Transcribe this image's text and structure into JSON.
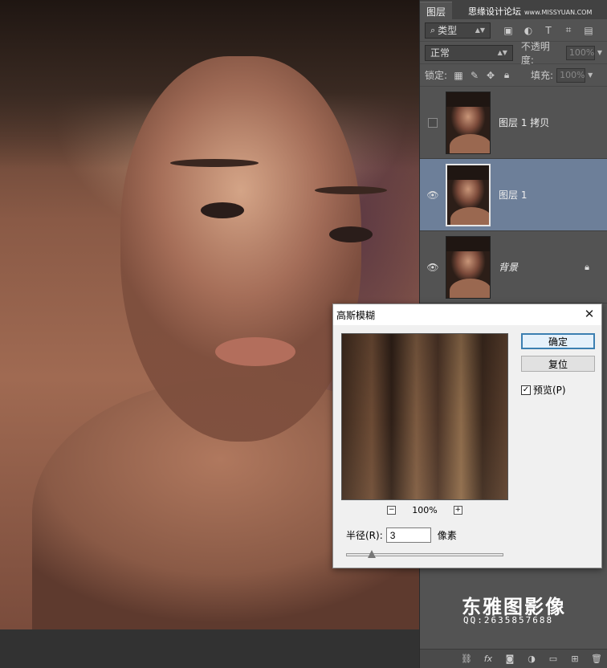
{
  "panel": {
    "tab_label": "图层",
    "watermark_top": "思缘设计论坛",
    "watermark_site": "www.MISSYUAN.COM",
    "filter_kind": "类型",
    "blend_mode": "正常",
    "opacity_label": "不透明度:",
    "opacity_value": "100%",
    "lock_label": "锁定:",
    "fill_label": "填充:",
    "fill_value": "100%",
    "layers": [
      {
        "name": "图层 1 拷贝",
        "visible": false,
        "selected": false
      },
      {
        "name": "图层 1",
        "visible": true,
        "selected": true
      },
      {
        "name": "背景",
        "visible": true,
        "selected": false,
        "locked": true
      }
    ],
    "logo_text": "东雅图影像",
    "logo_qq": "QQ:2635857688"
  },
  "dialog": {
    "title": "高斯模糊",
    "ok_label": "确定",
    "reset_label": "复位",
    "preview_label": "预览(P)",
    "preview_checked": true,
    "zoom_level": "100%",
    "radius_label": "半径(R):",
    "radius_value": "3",
    "radius_unit": "像素",
    "slider_fraction": 0.16
  }
}
